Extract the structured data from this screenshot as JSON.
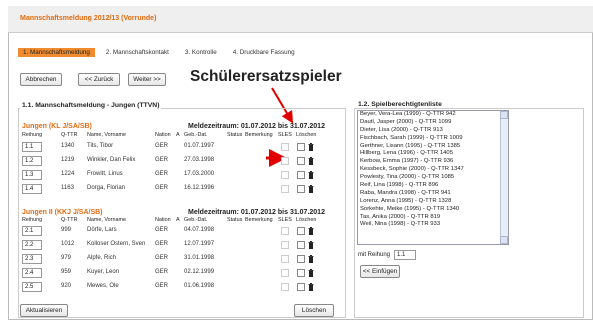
{
  "title": "Mannschaftsmeldung 2012/13 (Vorrunde)",
  "steps": [
    "1. Mannschaftsmeldung",
    "2. Mannschaftskontakt",
    "3. Kontrolle",
    "4. Druckbare Fassung"
  ],
  "buttons": {
    "cancel": "Abbrechen",
    "back": "<< Zurück",
    "next": "Weiter >>",
    "refresh": "Aktualisieren",
    "delete": "Löschen",
    "insert": "<< Einfügen"
  },
  "callout": "Schülerersatzspieler",
  "left_panel_title": "1.1. Mannschaftsmeldung - Jungen (TTVN)",
  "right_panel_title": "1.2. Spielberechtigtenliste",
  "columns": [
    "Reihung",
    "Q-TTR",
    "Name, Vorname",
    "Nation",
    "A",
    "Geb.-Dat.",
    "Status",
    "Bemerkung",
    "SLES",
    "Löschen"
  ],
  "group1": {
    "name": "Jungen (KL J/SA/SB)",
    "period": "Meldezeitraum: 01.07.2012 bis 31.07.2012",
    "rows": [
      {
        "reihung": "1.1",
        "qttr": "1340",
        "name": "Tits, Tibor",
        "nation": "GER",
        "geb": "01.07.1997"
      },
      {
        "reihung": "1.2",
        "qttr": "1219",
        "name": "Winkler, Dan Felix",
        "nation": "GER",
        "geb": "27.03.1998"
      },
      {
        "reihung": "1.3",
        "qttr": "1224",
        "name": "Frowitt, Linus",
        "nation": "GER",
        "geb": "17.03.2000"
      },
      {
        "reihung": "1.4",
        "qttr": "1163",
        "name": "Dorga, Florian",
        "nation": "GER",
        "geb": "16.12.1996"
      }
    ]
  },
  "group2": {
    "name": "Jungen II (KKJ J/SA/SB)",
    "period": "Meldezeitraum: 01.07.2012 bis 31.07.2012",
    "rows": [
      {
        "reihung": "2.1",
        "qttr": "999",
        "name": "Dörfe, Lars",
        "nation": "GER",
        "geb": "04.07.1998"
      },
      {
        "reihung": "2.2",
        "qttr": "1012",
        "name": "Kolloser Ostern, Sven",
        "nation": "GER",
        "geb": "12.07.1997"
      },
      {
        "reihung": "2.3",
        "qttr": "979",
        "name": "Alpfe, Rich",
        "nation": "GER",
        "geb": "31.01.1998"
      },
      {
        "reihung": "2.4",
        "qttr": "959",
        "name": "Kuyer, Leon",
        "nation": "GER",
        "geb": "02.12.1999"
      },
      {
        "reihung": "2.5",
        "qttr": "920",
        "name": "Mewes, Ole",
        "nation": "GER",
        "geb": "01.06.1998"
      }
    ]
  },
  "playerlist": [
    "Beyer, Vera-Lea (1999) - Q-TTR 942",
    "Dautl, Jasper (2000) - Q-TTR 1099",
    "Dieter, Lisa (2000) - Q-TTR 913",
    "Fischbach, Sarah (1999) - Q-TTR 1009",
    "Gerthner, Lisann (1995) - Q-TTR 1385",
    "Hillberg, Lena (1996) - Q-TTR 1405",
    "Kerbow, Emma (1997) - Q-TTR 936",
    "Kessbeck, Sophie (2000) - Q-TTR 1347",
    "Powlesty, Tina (2000) - Q-TTR 1085",
    "Reif, Lina (1998) - Q-TTR 896",
    "Raba, Mandra (1998) - Q-TTR 941",
    "Lorenz, Anna (1995) - Q-TTR 1328",
    "Sorkehte, Meike (1995) - Q-TTR 1340",
    "Tas, Anika (2000) - Q-TTR 819",
    "Weil, Nina (1998) - Q-TTR 933"
  ],
  "reihung_label": "mit Reihung",
  "reihung_value": "1.1",
  "colors": {
    "accent": "#e06b10",
    "step_active": "#f08c2e",
    "arrow": "#e00000"
  }
}
